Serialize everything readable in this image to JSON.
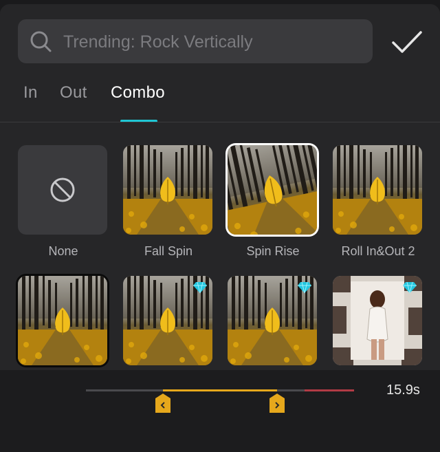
{
  "search": {
    "placeholder": "Trending: Rock Vertically"
  },
  "tabs": [
    {
      "label": "In",
      "active": false
    },
    {
      "label": "Out",
      "active": false
    },
    {
      "label": "Combo",
      "active": true
    }
  ],
  "animations": [
    {
      "label": "None",
      "icon": "none-icon",
      "selected": false,
      "premium": false
    },
    {
      "label": "Fall Spin",
      "selected": false,
      "premium": false
    },
    {
      "label": "Spin Rise",
      "selected": true,
      "premium": false
    },
    {
      "label": "Roll In&Out 2",
      "selected": false,
      "premium": false
    },
    {
      "label": "",
      "selected": false,
      "premium": false
    },
    {
      "label": "",
      "selected": false,
      "premium": true
    },
    {
      "label": "",
      "selected": false,
      "premium": true
    },
    {
      "label": "",
      "selected": false,
      "premium": true,
      "thumbnail": "portrait"
    }
  ],
  "timeline": {
    "duration": "15.9s"
  },
  "colors": {
    "accent": "#1fc6d4",
    "trim": "#e6a81c",
    "track_end": "#b23b45"
  }
}
